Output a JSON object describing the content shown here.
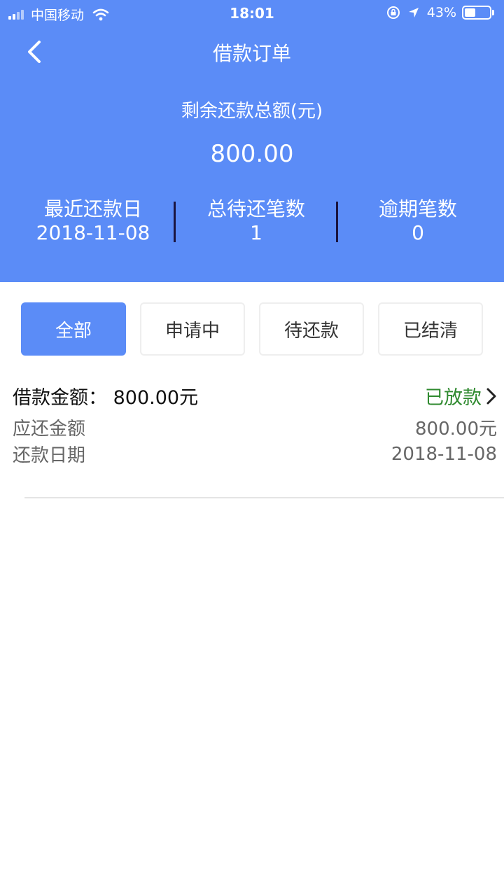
{
  "status_bar": {
    "carrier": "中国移动",
    "time": "18:01",
    "battery": "43%"
  },
  "header": {
    "title": "借款订单",
    "summary_label": "剩余还款总额(元)",
    "summary_value": "800.00",
    "stats": [
      {
        "label": "最近还款日",
        "value": "2018-11-08"
      },
      {
        "label": "总待还笔数",
        "value": "1"
      },
      {
        "label": "逾期笔数",
        "value": "0"
      }
    ],
    "background_color": "#5b8cf7"
  },
  "tabs": [
    {
      "label": "全部",
      "active": true
    },
    {
      "label": "申请中",
      "active": false
    },
    {
      "label": "待还款",
      "active": false
    },
    {
      "label": "已结清",
      "active": false
    }
  ],
  "orders": [
    {
      "loan_amount_label": "借款金额：",
      "loan_amount_value": "800.00元",
      "status": "已放款",
      "due_amount_label": "应还金额",
      "due_amount_value": "800.00元",
      "due_date_label": "还款日期",
      "due_date_value": "2018-11-08"
    }
  ],
  "icons": {
    "back": "chevron-left-icon",
    "detail": "chevron-right-icon",
    "signal": "cellular-signal-icon",
    "wifi": "wifi-icon",
    "lock": "orientation-lock-icon",
    "location": "location-arrow-icon",
    "battery": "battery-icon"
  },
  "colors": {
    "accent": "#5b8cf7",
    "status_green": "#2f8a2f"
  }
}
